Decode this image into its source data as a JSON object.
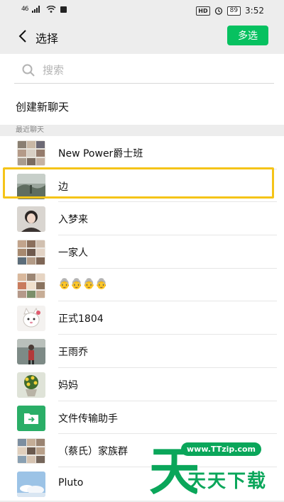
{
  "status_bar": {
    "signal": "46",
    "hd": "HD",
    "battery": "89",
    "time": "3:52"
  },
  "header": {
    "title": "选择",
    "multi_select_label": "多选"
  },
  "search": {
    "placeholder": "搜索"
  },
  "create_chat_label": "创建新聊天",
  "section_label": "最近聊天",
  "chats": [
    {
      "name": "New Power爵士班",
      "avatar_icon": "group-avatar-icon"
    },
    {
      "name": "边",
      "avatar_icon": "landscape-avatar-icon",
      "highlighted": true
    },
    {
      "name": "入梦来",
      "avatar_icon": "portrait-avatar-icon"
    },
    {
      "name": "一家人",
      "avatar_icon": "group-avatar-icon"
    },
    {
      "name": "👵👵👵👵",
      "avatar_icon": "group-avatar-icon"
    },
    {
      "name": "正式1804",
      "avatar_icon": "cartoon-avatar-icon"
    },
    {
      "name": "王雨乔",
      "avatar_icon": "portrait-avatar-icon"
    },
    {
      "name": "妈妈",
      "avatar_icon": "flower-avatar-icon"
    },
    {
      "name": "文件传输助手",
      "avatar_icon": "folder-icon"
    },
    {
      "name": "（蔡氏）家族群",
      "avatar_icon": "group-avatar-icon"
    },
    {
      "name": "Pluto",
      "avatar_icon": "sky-avatar-icon"
    }
  ],
  "watermark": {
    "url": "www.TTzip.com",
    "text": "天天下载",
    "big_char": "天"
  },
  "colors": {
    "accent": "#07c160",
    "highlight": "#f5c418",
    "watermark": "#0aa65a"
  }
}
